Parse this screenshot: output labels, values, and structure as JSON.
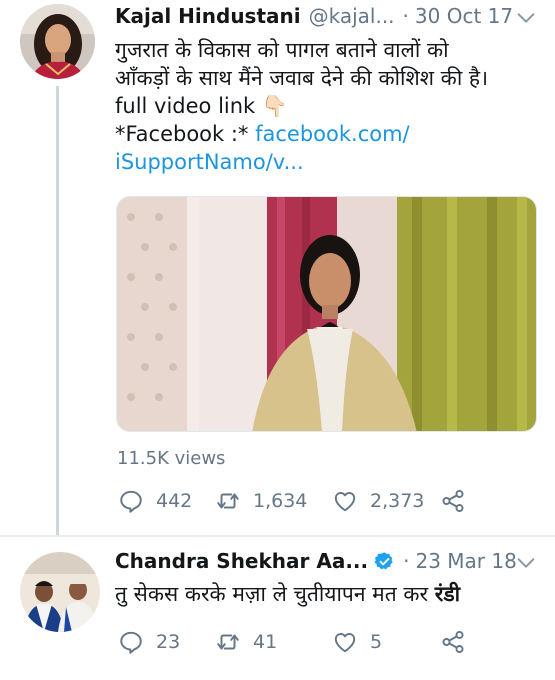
{
  "tweets": [
    {
      "user_name": "Kajal Hindustani",
      "handle": "@kajal...",
      "separator": "·",
      "date": "30 Oct 17",
      "text_lines": [
        "गुजरात के विकास को पागल बताने वालों को",
        "आँकड़ों के साथ मैंने जवाब देने की कोशिश की है।",
        "full video link 👇🏻"
      ],
      "link_prefix": "*Facebook :* ",
      "link_line1": "facebook.com/",
      "link_line2": "iSupportNamo/v...",
      "views": "11.5K views",
      "replies": "442",
      "retweets": "1,634",
      "likes": "2,373"
    },
    {
      "user_name": "Chandra Shekhar Aa...",
      "separator": "·",
      "date": "23 Mar 18",
      "text_main": "तु सेकस करके मज़ा ले चुतीयापन मत कर ",
      "text_bold": "रंडी",
      "replies": "23",
      "retweets": "41",
      "likes": "5"
    }
  ],
  "icons": {
    "reply": "reply-icon",
    "retweet": "retweet-icon",
    "like": "heart-icon",
    "share": "share-icon",
    "chevron": "chevron-down-icon",
    "verified": "verified-badge-icon"
  },
  "colors": {
    "text": "#14171a",
    "secondary": "#657786",
    "link": "#1b95e0",
    "verified": "#1da1f2",
    "divider": "#e6ecf0"
  }
}
